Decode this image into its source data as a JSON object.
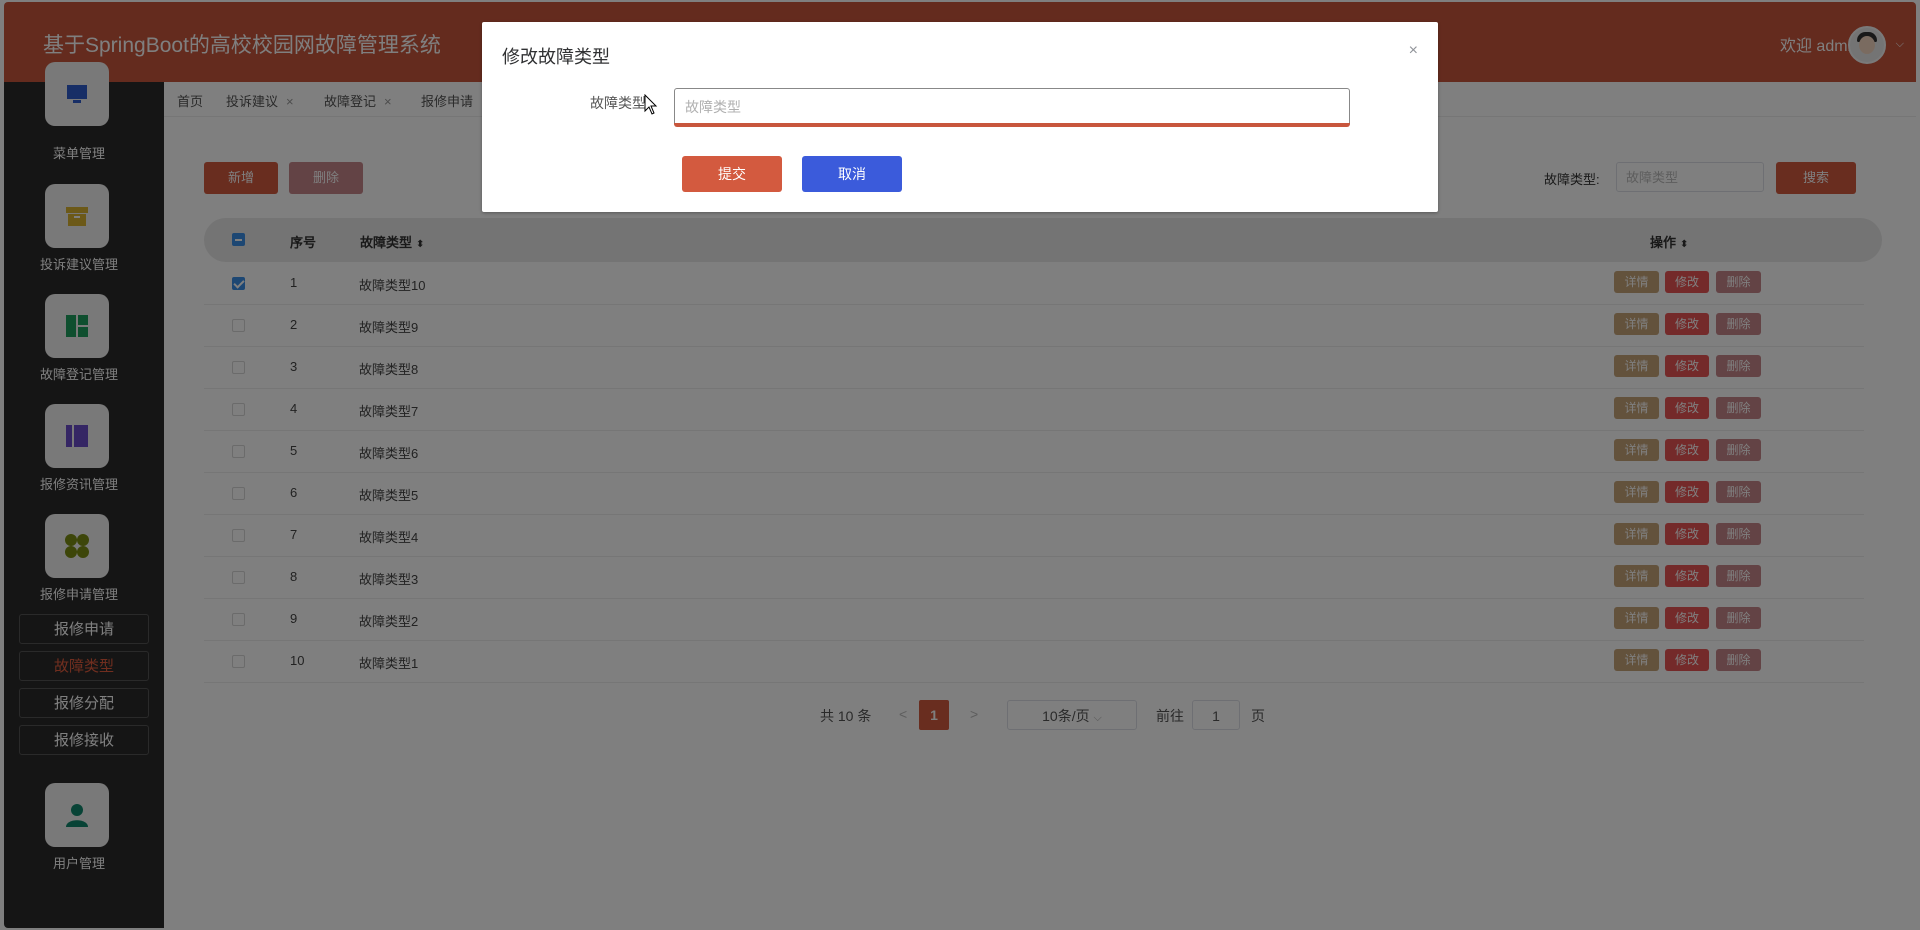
{
  "header": {
    "title": "基于SpringBoot的高校校园网故障管理系统",
    "welcome": "欢迎 admin",
    "caret": "⌵"
  },
  "sidebar": {
    "menus": [
      {
        "label": "菜单管理",
        "icon": "monitor-icon",
        "color": "#2f5dcc"
      },
      {
        "label": "投诉建议管理",
        "icon": "archive-box-icon",
        "color": "#d9b230"
      },
      {
        "label": "故障登记管理",
        "icon": "dashboard-layout-icon",
        "color": "#1f9e5e"
      },
      {
        "label": "报修资讯管理",
        "icon": "book-icon",
        "color": "#6a4cc9"
      },
      {
        "label": "报修申请管理",
        "icon": "four-leaf-icon",
        "color": "#7a8c12"
      },
      {
        "label": "用户管理",
        "icon": "user-icon",
        "color": "#10876c"
      }
    ],
    "sub_items": [
      "报修申请",
      "故障类型",
      "报修分配",
      "报修接收"
    ],
    "active_sub": "故障类型"
  },
  "tabs": [
    {
      "label": "首页"
    },
    {
      "label": "投诉建议"
    },
    {
      "label": "故障登记"
    },
    {
      "label": "报修申请"
    }
  ],
  "toolbar": {
    "add": "新增",
    "delete": "删除",
    "search_label": "故障类型:",
    "search_placeholder": "故障类型",
    "search_button": "搜索"
  },
  "table": {
    "headers": {
      "index": "序号",
      "type": "故障类型",
      "ops": "操作"
    },
    "rows": [
      {
        "index": "1",
        "type": "故障类型10",
        "checked": true
      },
      {
        "index": "2",
        "type": "故障类型9",
        "checked": false
      },
      {
        "index": "3",
        "type": "故障类型8",
        "checked": false
      },
      {
        "index": "4",
        "type": "故障类型7",
        "checked": false
      },
      {
        "index": "5",
        "type": "故障类型6",
        "checked": false
      },
      {
        "index": "6",
        "type": "故障类型5",
        "checked": false
      },
      {
        "index": "7",
        "type": "故障类型4",
        "checked": false
      },
      {
        "index": "8",
        "type": "故障类型3",
        "checked": false
      },
      {
        "index": "9",
        "type": "故障类型2",
        "checked": false
      },
      {
        "index": "10",
        "type": "故障类型1",
        "checked": false
      }
    ],
    "op_labels": {
      "detail": "详情",
      "edit": "修改",
      "delete": "删除"
    }
  },
  "pagination": {
    "total": "共 10 条",
    "prev": "<",
    "current": "1",
    "next": ">",
    "page_size": "10条/页",
    "goto_label": "前往",
    "goto_value": "1",
    "page_suffix": "页"
  },
  "dialog": {
    "title": "修改故障类型",
    "close": "×",
    "field_label": "故障类型",
    "field_placeholder": "故障类型",
    "submit": "提交",
    "cancel": "取消"
  },
  "colors": {
    "header": "#c8563d",
    "sidebar": "#2b2b2b",
    "primary": "#d35a3f",
    "cancel": "#3b5bdb"
  }
}
